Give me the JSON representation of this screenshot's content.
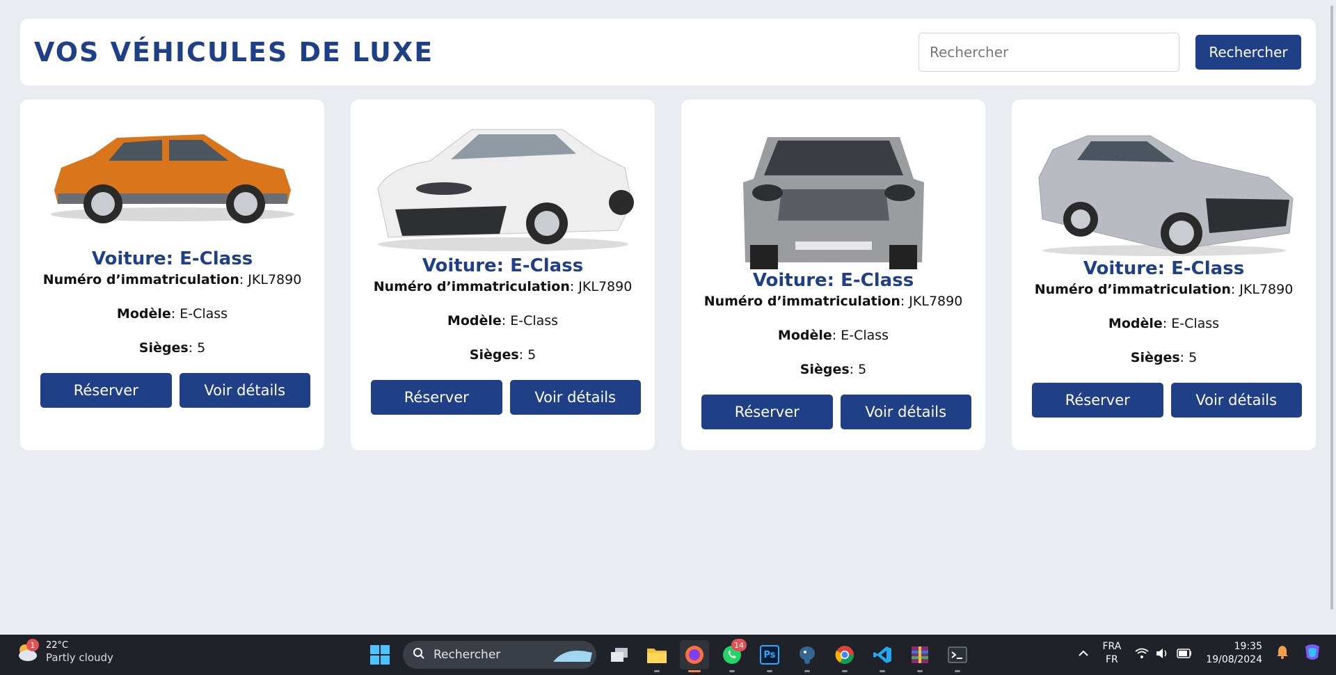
{
  "header": {
    "title": "VOS VÉHICULES DE LUXE",
    "search_placeholder": "Rechercher",
    "search_button": "Rechercher"
  },
  "cards": [
    {
      "title": "Voiture: E-Class",
      "plate_label": "Numéro d’immatriculation",
      "plate_value": ": JKL7890",
      "model_label": "Modèle",
      "model_value": ": E-Class",
      "seats_label": "Sièges",
      "seats_value": ": 5",
      "reserve_label": "Réserver",
      "details_label": "Voir détails",
      "car_color": "#d9761c",
      "car_type": "suv-side"
    },
    {
      "title": "Voiture: E-Class",
      "plate_label": "Numéro d’immatriculation",
      "plate_value": ": JKL7890",
      "model_label": "Modèle",
      "model_value": ": E-Class",
      "seats_label": "Sièges",
      "seats_value": ": 5",
      "reserve_label": "Réserver",
      "details_label": "Voir détails",
      "car_color": "#eeeeee",
      "car_type": "sedan-front"
    },
    {
      "title": "Voiture: E-Class",
      "plate_label": "Numéro d’immatriculation",
      "plate_value": ": JKL7890",
      "model_label": "Modèle",
      "model_value": ": E-Class",
      "seats_label": "Sièges",
      "seats_value": ": 5",
      "reserve_label": "Réserver",
      "details_label": "Voir détails",
      "car_color": "#9a9ca0",
      "car_type": "suv-front"
    },
    {
      "title": "Voiture: E-Class",
      "plate_label": "Numéro d’immatriculation",
      "plate_value": ": JKL7890",
      "model_label": "Modèle",
      "model_value": ": E-Class",
      "seats_label": "Sièges",
      "seats_value": ": 5",
      "reserve_label": "Réserver",
      "details_label": "Voir détails",
      "car_color": "#b8bcc2",
      "car_type": "sedan-side"
    }
  ],
  "taskbar": {
    "weather_temp": "22°C",
    "weather_condition": "Partly cloudy",
    "weather_badge": "1",
    "search_label": "Rechercher",
    "whatsapp_badge": "14",
    "photoshop_label": "Ps",
    "lang_top": "FRA",
    "lang_bottom": "FR",
    "time": "19:35",
    "date": "19/08/2024"
  },
  "colors": {
    "accent": "#1f3f86",
    "background": "#e9edf2",
    "taskbar": "#1f2329"
  }
}
